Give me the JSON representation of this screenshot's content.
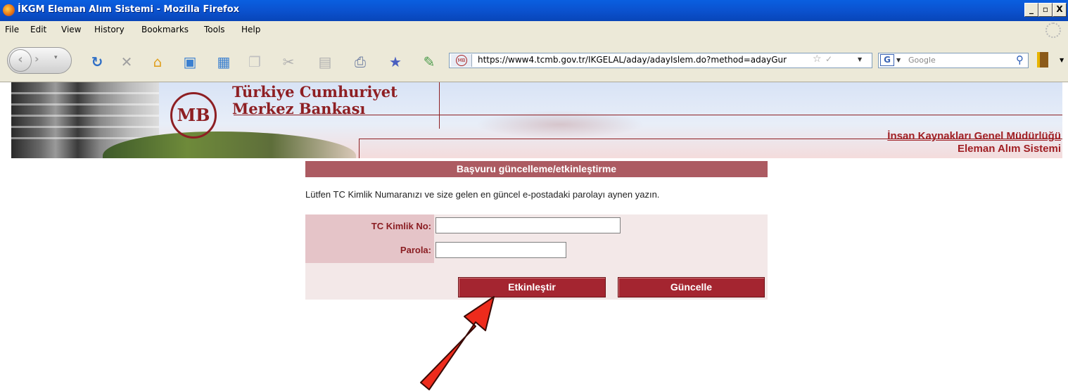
{
  "window": {
    "title": "İKGM Eleman Alım Sistemi - Mozilla Firefox",
    "buttons": [
      "_",
      "▫",
      "X"
    ]
  },
  "menu": {
    "items": [
      "File",
      "Edit",
      "View",
      "History",
      "Bookmarks",
      "Tools",
      "Help"
    ]
  },
  "toolbar": {
    "icons": [
      "back-icon",
      "forward-icon",
      "reload-icon",
      "stop-icon",
      "home-icon",
      "new-tab-icon",
      "new-window-icon",
      "copy-icon",
      "cut-icon",
      "paste-icon",
      "print-icon",
      "bookmark-icon",
      "edit-icon"
    ],
    "url": "https://www4.tcmb.gov.tr/IKGELAL/aday/adayIslem.do?method=adayGur",
    "search_placeholder": "Google",
    "search_engine_letter": "G"
  },
  "banner": {
    "bank_line1": "Türkiye Cumhuriyet",
    "bank_line2": "Merkez Bankası",
    "logo_text": "MB",
    "dept_line1": "İnsan Kaynakları Genel Müdürlüğü",
    "dept_line2": "Eleman Alım Sistemi"
  },
  "form": {
    "title": "Başvuru güncelleme/etkinleştirme",
    "intro": "Lütfen TC Kimlik Numaranızı ve size gelen en güncel e-postadaki parolayı aynen yazın.",
    "tc_label": "TC Kimlik No:",
    "tc_value": "",
    "password_label": "Parola:",
    "password_value": "",
    "activate_button": "Etkinleştir",
    "update_button": "Güncelle"
  },
  "colors": {
    "accent": "#a42530",
    "panel_header": "#ac5b62",
    "label_bg": "#e5c4c8",
    "arrow": "#ee2b1c"
  }
}
